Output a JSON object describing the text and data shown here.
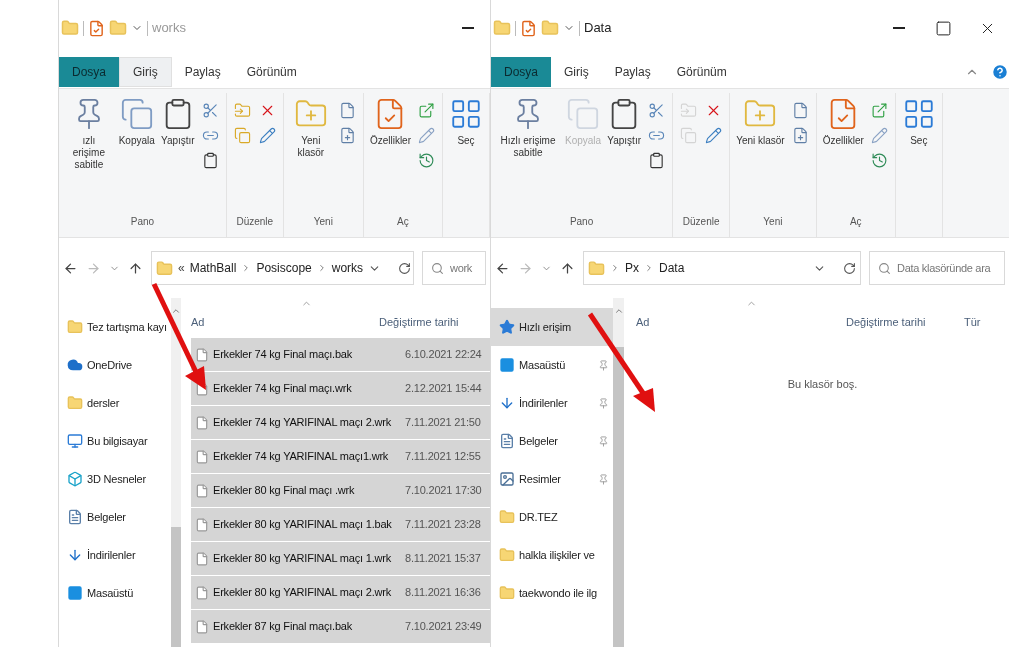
{
  "windows": [
    {
      "title": "works",
      "window_buttons": [
        {
          "kind": "minimize"
        }
      ],
      "ribbon_tabs": [
        {
          "label": "Dosya",
          "kind": "file",
          "selected": false
        },
        {
          "label": "Giriş",
          "kind": "tab",
          "selected": true
        },
        {
          "label": "Paylaş",
          "kind": "tab",
          "selected": false
        },
        {
          "label": "Görünüm",
          "kind": "tab",
          "selected": false
        }
      ],
      "ribbon_groups": [
        {
          "label": "Pano",
          "buttons": [
            {
              "kind": "pin",
              "label": "ızlı erişime sabitle",
              "disabled": false
            },
            {
              "kind": "copy",
              "label": "Kopyala",
              "disabled": false
            },
            {
              "kind": "paste",
              "label": "Yapıştır",
              "disabled": false
            },
            {
              "kind": "small-stack",
              "disabled": false
            }
          ]
        },
        {
          "label": "Düzenle",
          "buttons": [
            {
              "kind": "move-copy",
              "disabled": false
            },
            {
              "kind": "delete-rename",
              "disabled": false
            }
          ]
        },
        {
          "label": "Yeni",
          "buttons": [
            {
              "kind": "new-folder",
              "label": "Yeni klasör",
              "disabled": false
            },
            {
              "kind": "new-items",
              "disabled": false
            }
          ]
        },
        {
          "label": "Aç",
          "buttons": [
            {
              "kind": "properties",
              "label": "Özellikler",
              "disabled": false
            },
            {
              "kind": "open-items",
              "disabled": false
            }
          ]
        },
        {
          "buttons": [
            {
              "kind": "select",
              "label": "Seç",
              "disabled": false
            }
          ]
        }
      ],
      "address": {
        "overflow_mark": "«",
        "segments": [
          "MathBall",
          "Posiscope",
          "works"
        ]
      },
      "search": {
        "placeholder": "work"
      },
      "nav": [
        {
          "label": "Tez tartışma kayı",
          "kind": "folder",
          "pinned": false,
          "selected": false
        },
        {
          "label": "OneDrive",
          "kind": "cloud",
          "pinned": false,
          "selected": false
        },
        {
          "label": "dersler",
          "kind": "folder",
          "pinned": false,
          "selected": false
        },
        {
          "label": "Bu bilgisayar",
          "kind": "computer",
          "pinned": false,
          "selected": false
        },
        {
          "label": "3D Nesneler",
          "kind": "cube",
          "pinned": false,
          "selected": false
        },
        {
          "label": "Belgeler",
          "kind": "document",
          "pinned": false,
          "selected": false
        },
        {
          "label": "İndirilenler",
          "kind": "download",
          "pinned": false,
          "selected": false
        },
        {
          "label": "Masaüstü",
          "kind": "desktop",
          "pinned": false,
          "selected": false
        }
      ],
      "columns": [
        "Ad",
        "Değiştirme tarihi"
      ],
      "rows": [
        {
          "name": "Erkekler 74 kg Final maçı.bak",
          "date": "6.10.2021 22:24",
          "selected": true
        },
        {
          "name": "Erkekler 74 kg Final maçı.wrk",
          "date": "2.12.2021 15:44",
          "selected": true
        },
        {
          "name": "Erkekler 74 kg YARIFINAL maçı 2.wrk",
          "date": "7.11.2021 21:50",
          "selected": true
        },
        {
          "name": "Erkekler 74 kg YARIFINAL maçı1.wrk",
          "date": "7.11.2021 12:55",
          "selected": true
        },
        {
          "name": "Erkekler 80 kg Final maçı .wrk",
          "date": "7.10.2021 17:30",
          "selected": true
        },
        {
          "name": "Erkekler 80 kg YARIFINAL maçı 1.bak",
          "date": "7.11.2021 23:28",
          "selected": true
        },
        {
          "name": "Erkekler 80 kg YARIFINAL maçı 1.wrk",
          "date": "8.11.2021 15:37",
          "selected": true
        },
        {
          "name": "Erkekler 80 kg YARIFINAL maçı 2.wrk",
          "date": "8.11.2021 16:36",
          "selected": true
        },
        {
          "name": "Erkekler 87 kg Final maçı.bak",
          "date": "7.10.2021 23:49",
          "selected": true
        }
      ]
    },
    {
      "title": "Data",
      "window_buttons": [
        {
          "kind": "minimize"
        },
        {
          "kind": "maximize"
        },
        {
          "kind": "close"
        }
      ],
      "ribbon_extras": [
        {
          "kind": "collapse"
        },
        {
          "kind": "help"
        }
      ],
      "ribbon_tabs": [
        {
          "label": "Dosya",
          "kind": "file",
          "selected": false
        },
        {
          "label": "Giriş",
          "kind": "tab",
          "selected": false
        },
        {
          "label": "Paylaş",
          "kind": "tab",
          "selected": false
        },
        {
          "label": "Görünüm",
          "kind": "tab",
          "selected": false
        }
      ],
      "ribbon_groups": [
        {
          "label": "Pano",
          "buttons": [
            {
              "kind": "pin",
              "label": "Hızlı erişime sabitle",
              "disabled": false
            },
            {
              "kind": "copy",
              "label": "Kopyala",
              "disabled": true
            },
            {
              "kind": "paste",
              "label": "Yapıştır",
              "disabled": false
            },
            {
              "kind": "small-stack",
              "disabled": false
            }
          ]
        },
        {
          "label": "Düzenle",
          "buttons": [
            {
              "kind": "move-copy",
              "disabled": true
            },
            {
              "kind": "delete-rename",
              "disabled": false
            }
          ]
        },
        {
          "label": "Yeni",
          "buttons": [
            {
              "kind": "new-folder",
              "label": "Yeni klasör",
              "disabled": false
            },
            {
              "kind": "new-items",
              "disabled": false
            }
          ]
        },
        {
          "label": "Aç",
          "buttons": [
            {
              "kind": "properties",
              "label": "Özellikler",
              "disabled": false
            },
            {
              "kind": "open-items",
              "disabled": false
            }
          ]
        },
        {
          "buttons": [
            {
              "kind": "select",
              "label": "Seç",
              "disabled": false
            }
          ]
        }
      ],
      "address": {
        "segments": [
          "Px",
          "Data"
        ]
      },
      "search": {
        "placeholder": "Data klasöründe ara"
      },
      "nav": [
        {
          "label": "Hızlı erişim",
          "kind": "star",
          "pinned": false,
          "selected": true
        },
        {
          "label": "Masaüstü",
          "kind": "desktop",
          "pinned": true,
          "selected": false
        },
        {
          "label": "İndirilenler",
          "kind": "download",
          "pinned": true,
          "selected": false
        },
        {
          "label": "Belgeler",
          "kind": "document",
          "pinned": true,
          "selected": false
        },
        {
          "label": "Resimler",
          "kind": "image",
          "pinned": true,
          "selected": false
        },
        {
          "label": "DR.TEZ",
          "kind": "folder",
          "pinned": false,
          "selected": false
        },
        {
          "label": "halkla ilişkiler ve",
          "kind": "folder",
          "pinned": false,
          "selected": false
        },
        {
          "label": "taekwondo ile ilg",
          "kind": "folder",
          "pinned": false,
          "selected": false
        }
      ],
      "columns": [
        "Ad",
        "Değiştirme tarihi",
        "Tür"
      ],
      "empty_message": "Bu klasör boş."
    }
  ]
}
